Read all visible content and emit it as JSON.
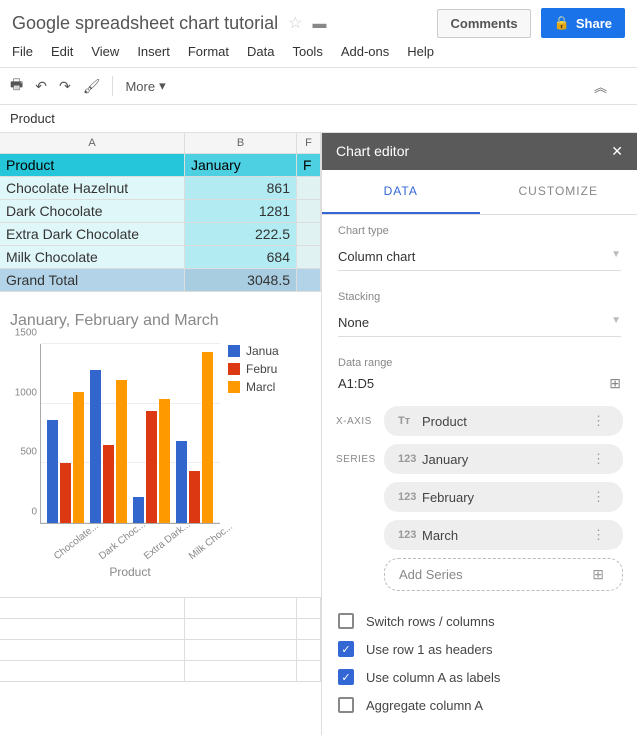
{
  "doc_title": "Google spreadsheet chart tutorial",
  "header": {
    "comments": "Comments",
    "share": "Share"
  },
  "menu": [
    "File",
    "Edit",
    "View",
    "Insert",
    "Format",
    "Data",
    "Tools",
    "Add-ons",
    "Help"
  ],
  "toolbar": {
    "more": "More"
  },
  "formula_bar": "Product",
  "columns": [
    "A",
    "B",
    "F"
  ],
  "table": {
    "header": [
      "Product",
      "January",
      "F"
    ],
    "rows": [
      [
        "Chocolate Hazelnut",
        "861"
      ],
      [
        "Dark Chocolate",
        "1281"
      ],
      [
        "Extra Dark Chocolate",
        "222.5"
      ],
      [
        "Milk Chocolate",
        "684"
      ]
    ],
    "total": [
      "Grand Total",
      "3048.5"
    ]
  },
  "chart_data": {
    "type": "bar",
    "title": "January, February and March",
    "xlabel": "Product",
    "ylabel": "",
    "ylim": [
      0,
      1500
    ],
    "yticks": [
      0,
      500,
      1000,
      1500
    ],
    "categories": [
      "Chocolate...",
      "Dark Choc...",
      "Extra Dark...",
      "Milk Choc..."
    ],
    "series": [
      {
        "name": "Janua",
        "color": "#3366cc",
        "values": [
          861,
          1281,
          222,
          684
        ]
      },
      {
        "name": "Febru",
        "color": "#dc3912",
        "values": [
          500,
          650,
          940,
          440
        ]
      },
      {
        "name": "Marcl",
        "color": "#ff9900",
        "values": [
          1100,
          1200,
          1040,
          1430
        ]
      }
    ]
  },
  "editor": {
    "title": "Chart editor",
    "tabs": [
      "DATA",
      "CUSTOMIZE"
    ],
    "chart_type_label": "Chart type",
    "chart_type_value": "Column chart",
    "stacking_label": "Stacking",
    "stacking_value": "None",
    "range_label": "Data range",
    "range_value": "A1:D5",
    "xaxis_label": "X-AXIS",
    "xaxis_value": "Product",
    "series_label": "SERIES",
    "series": [
      "January",
      "February",
      "March"
    ],
    "add_series": "Add Series",
    "checks": [
      {
        "label": "Switch rows / columns",
        "checked": false
      },
      {
        "label": "Use row 1 as headers",
        "checked": true
      },
      {
        "label": "Use column A as labels",
        "checked": true
      },
      {
        "label": "Aggregate column A",
        "checked": false
      }
    ]
  }
}
